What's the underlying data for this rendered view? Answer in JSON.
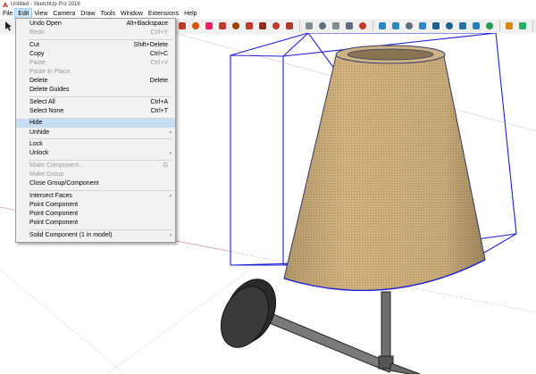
{
  "window": {
    "title": "Untitled - SketchUp Pro 2016"
  },
  "menubar": {
    "items": [
      "File",
      "Edit",
      "View",
      "Camera",
      "Draw",
      "Tools",
      "Window",
      "Extensions",
      "Help"
    ],
    "active": "Edit"
  },
  "edit_menu": {
    "undo_open": {
      "label": "Undo Open",
      "shortcut": "Alt+Backspace"
    },
    "redo": {
      "label": "Redo",
      "shortcut": "Ctrl+Y"
    },
    "cut": {
      "label": "Cut",
      "shortcut": "Shift+Delete"
    },
    "copy": {
      "label": "Copy",
      "shortcut": "Ctrl+C"
    },
    "paste": {
      "label": "Paste",
      "shortcut": "Ctrl+V"
    },
    "paste_in_place": {
      "label": "Paste In Place"
    },
    "delete": {
      "label": "Delete",
      "shortcut": "Delete"
    },
    "delete_guides": {
      "label": "Delete Guides"
    },
    "select_all": {
      "label": "Select All",
      "shortcut": "Ctrl+A"
    },
    "select_none": {
      "label": "Select None",
      "shortcut": "Ctrl+T"
    },
    "hide": {
      "label": "Hide"
    },
    "unhide": {
      "label": "Unhide",
      "arrow": "›"
    },
    "lock": {
      "label": "Lock"
    },
    "unlock": {
      "label": "Unlock",
      "arrow": "›"
    },
    "make_component": {
      "label": "Make Component...",
      "shortcut": "G"
    },
    "make_group": {
      "label": "Make Group"
    },
    "close_group": {
      "label": "Close Group/Component"
    },
    "intersect_faces": {
      "label": "Intersect Faces",
      "arrow": "›"
    },
    "point_component_1": {
      "label": "Point Component"
    },
    "point_component_2": {
      "label": "Point Component"
    },
    "point_component_3": {
      "label": "Point Component"
    },
    "solid_component": {
      "label": "Solid Component (1 in model)",
      "arrow": "›"
    }
  },
  "toolbar": {
    "icons": [
      {
        "name": "component-icon",
        "color": "#c0392b"
      },
      {
        "name": "paint-bucket-icon",
        "color": "#d35400"
      },
      {
        "name": "eraser-icon",
        "color": "#e91e63"
      },
      {
        "name": "move-icon",
        "color": "#c0392b"
      },
      {
        "name": "push-pull-icon",
        "color": "#a04000"
      },
      {
        "name": "rotate-icon",
        "color": "#c0392b"
      },
      {
        "name": "follow-me-icon",
        "color": "#922b21"
      },
      {
        "name": "scale-icon",
        "color": "#c0392b"
      },
      {
        "name": "offset-icon",
        "color": "#b03a2e"
      },
      {
        "name": "tape-measure-icon",
        "color": "#7f8c8d"
      },
      {
        "name": "dimension-icon",
        "color": "#5d6d7e"
      },
      {
        "name": "protractor-icon",
        "color": "#7f8c8d"
      },
      {
        "name": "text-icon",
        "color": "#5d6d7e"
      },
      {
        "name": "axes-icon",
        "color": "#c0392b"
      },
      {
        "name": "3d-text-icon",
        "color": "#2e86c1"
      },
      {
        "name": "orbit-icon",
        "color": "#2e86c1"
      },
      {
        "name": "pan-icon",
        "color": "#5d6d7e"
      },
      {
        "name": "zoom-icon",
        "color": "#2e86c1"
      },
      {
        "name": "zoom-window-icon",
        "color": "#1f618d"
      },
      {
        "name": "zoom-extents-icon",
        "color": "#1f618d"
      },
      {
        "name": "position-camera-icon",
        "color": "#2471a3"
      },
      {
        "name": "walk-icon",
        "color": "#2980b9"
      },
      {
        "name": "look-around-icon",
        "color": "#239b56"
      },
      {
        "name": "section-plane-icon",
        "color": "#d68910"
      },
      {
        "name": "geo-location-icon",
        "color": "#27ae60"
      },
      {
        "name": "3d-warehouse-icon",
        "color": "#c0392b"
      },
      {
        "name": "extension-warehouse-icon",
        "color": "#a93226"
      },
      {
        "name": "layout-icon",
        "color": "#2874a6"
      },
      {
        "name": "send-to-layout-icon",
        "color": "#2e86c1"
      },
      {
        "name": "extension-manager-icon",
        "color": "#17a589"
      },
      {
        "name": "style-icon",
        "color": "#cb4335"
      },
      {
        "name": "ruby-console-icon",
        "color": "#b03a2e"
      }
    ]
  },
  "theme": {
    "menu_highlight": "#c5dcf3",
    "selection_box": "#1f1fd6",
    "shade_color": "#c9a974"
  }
}
